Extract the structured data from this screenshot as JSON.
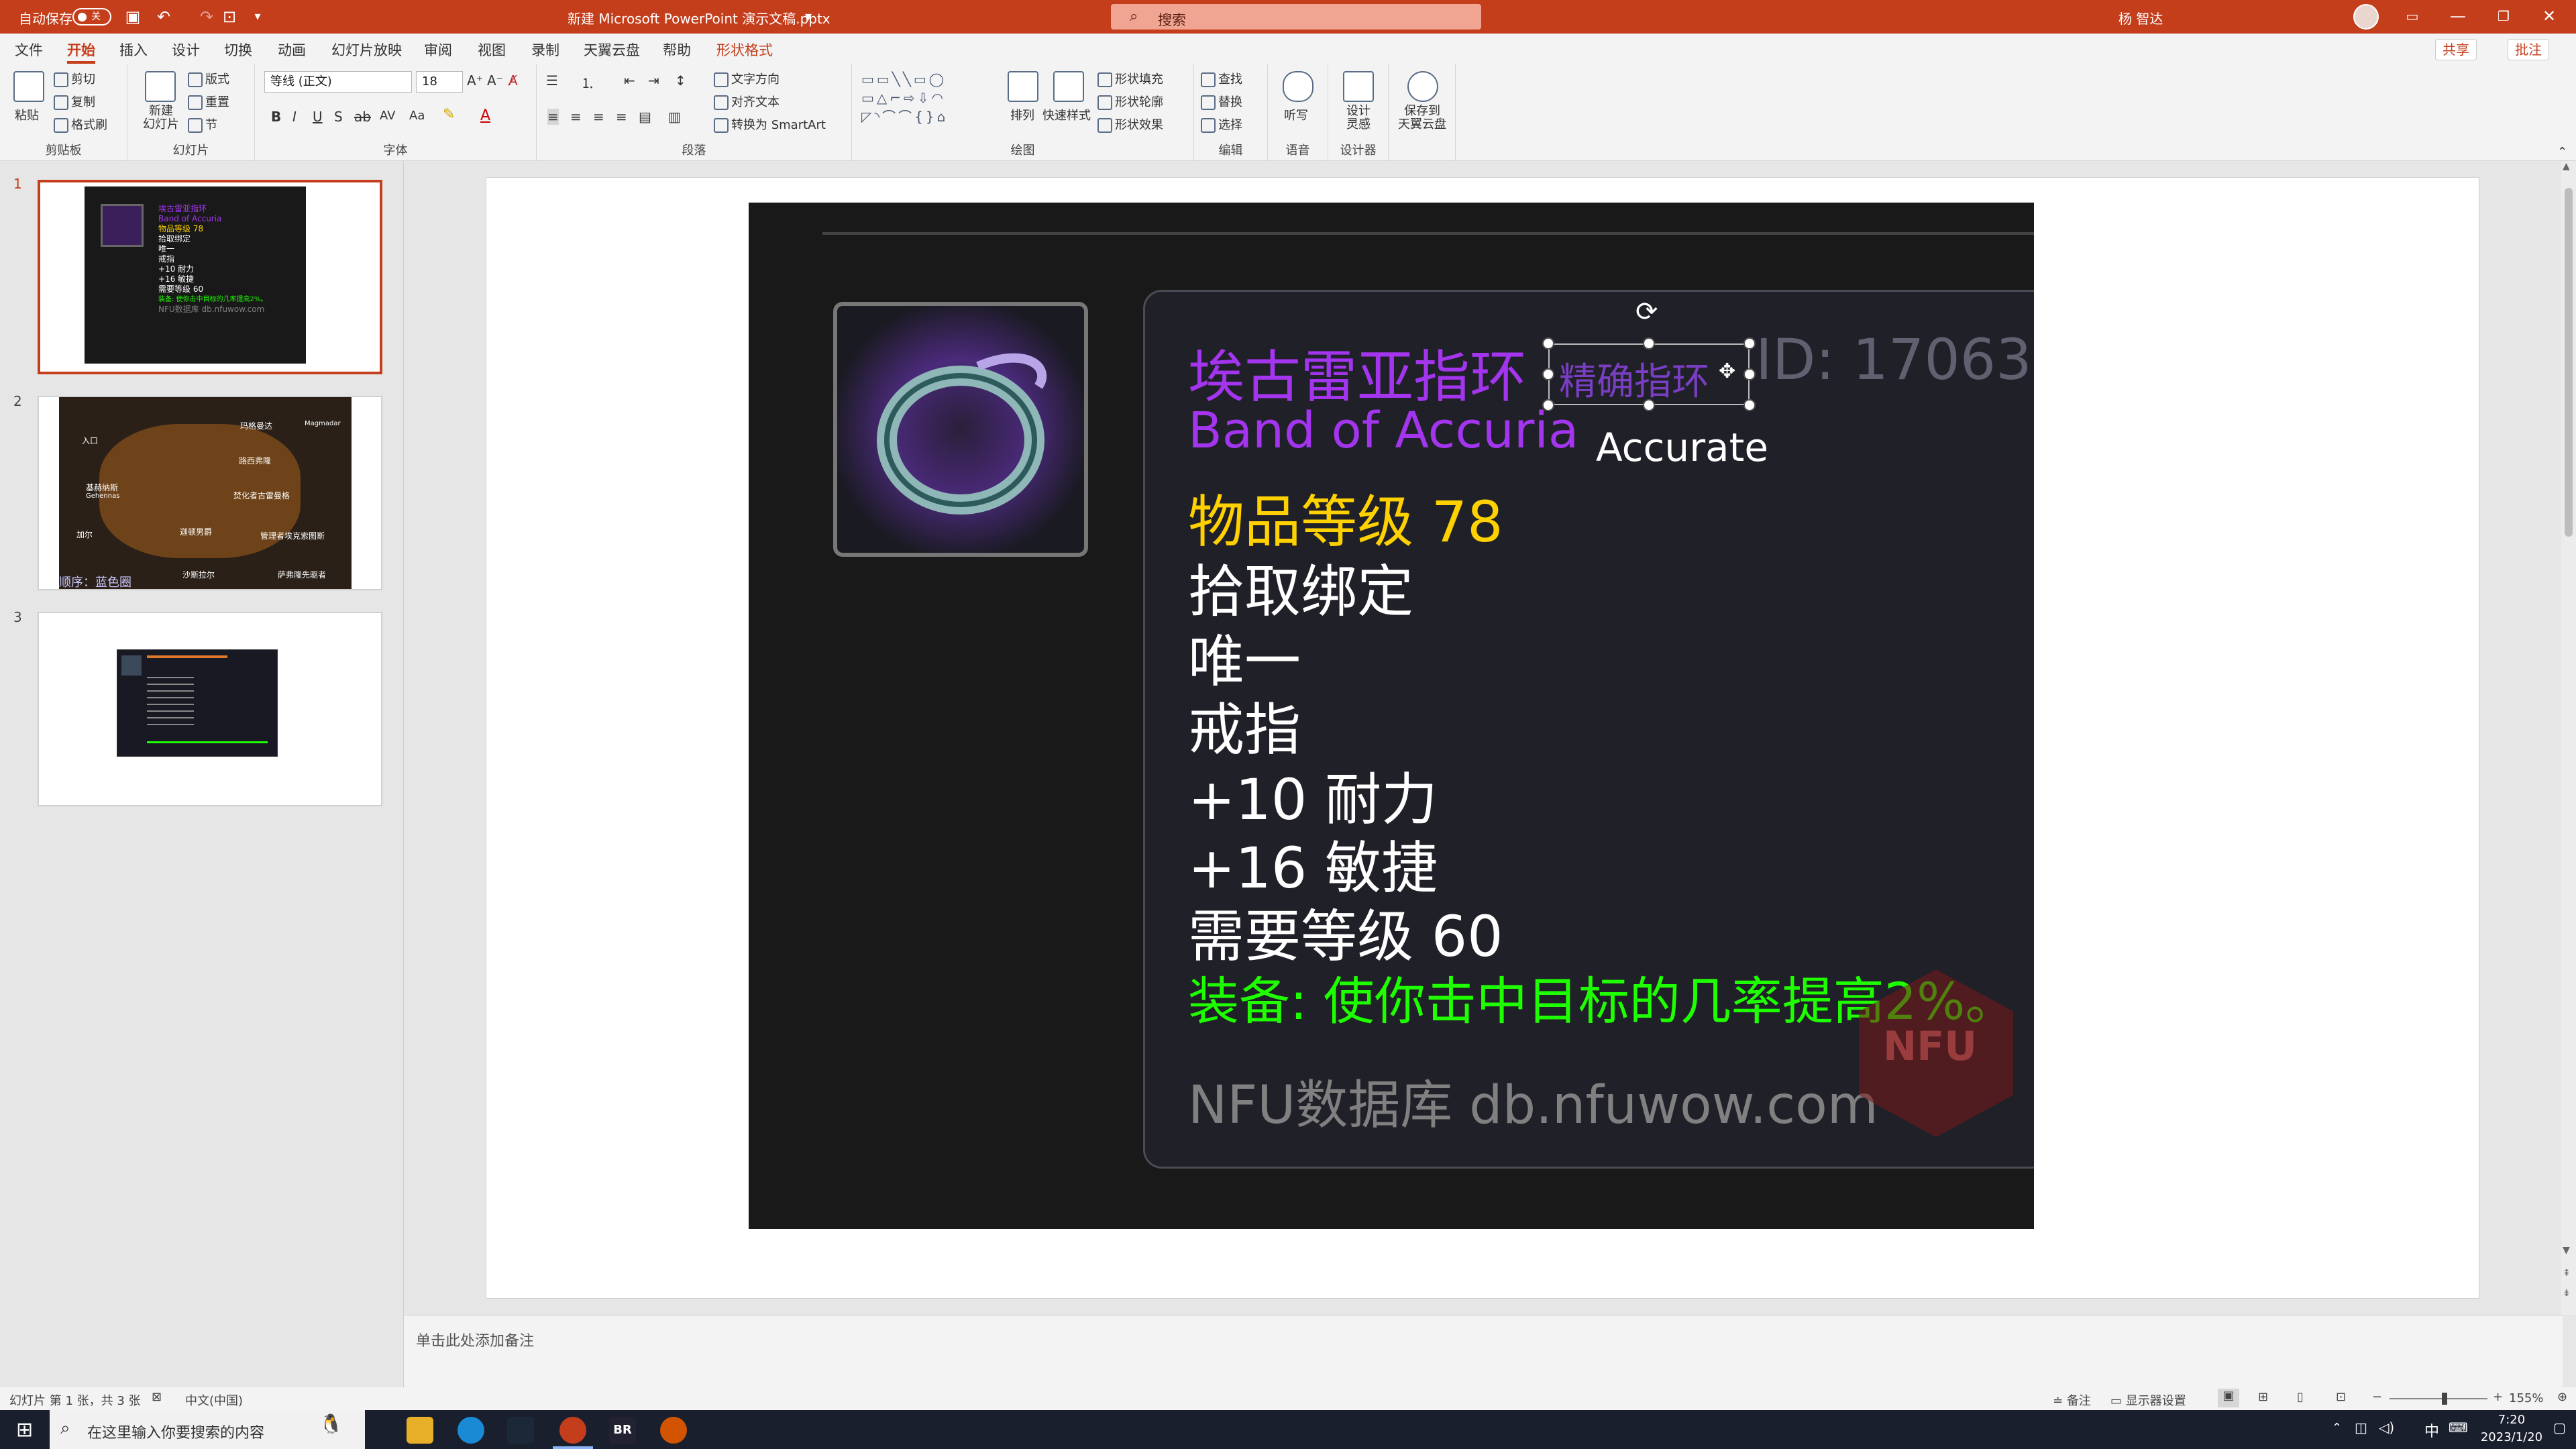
{
  "titlebar": {
    "autosave": "自动保存",
    "autosave_state": "关",
    "filename": "新建 Microsoft PowerPoint 演示文稿.pptx",
    "search_placeholder": "搜索",
    "user": "杨 智达",
    "bg_color": "#c43e1c"
  },
  "menu": {
    "tabs": [
      "文件",
      "开始",
      "插入",
      "设计",
      "切换",
      "动画",
      "幻灯片放映",
      "审阅",
      "视图",
      "录制",
      "天翼云盘",
      "帮助",
      "形状格式"
    ],
    "active": "开始",
    "share": "共享",
    "comment": "批注"
  },
  "ribbon": {
    "clipboard": {
      "paste": "粘贴",
      "cut": "剪切",
      "copy": "复制",
      "format_painter": "格式刷",
      "label": "剪贴板"
    },
    "slides": {
      "new_slide": "新建\n幻灯片",
      "layout": "版式",
      "reset": "重置",
      "section": "节",
      "label": "幻灯片"
    },
    "font": {
      "name": "等线 (正文)",
      "size": "18",
      "label": "字体"
    },
    "paragraph": {
      "text_direction": "文字方向",
      "align_text": "对齐文本",
      "smartart": "转换为 SmartArt",
      "label": "段落"
    },
    "drawing": {
      "arrange": "排列",
      "quick_styles": "快速样式",
      "fill": "形状填充",
      "outline": "形状轮廓",
      "effects": "形状效果",
      "label": "绘图"
    },
    "editing": {
      "find": "查找",
      "replace": "替换",
      "select": "选择",
      "label": "编辑"
    },
    "voice": {
      "dictate": "听写",
      "label": "语音"
    },
    "designer": {
      "ideas": "设计\n灵感",
      "label": "设计器"
    },
    "cloud": {
      "save": "保存到\n天翼云盘"
    }
  },
  "slides_panel": {
    "slides": [
      {
        "number": "1",
        "selected": true
      },
      {
        "number": "2",
        "selected": false,
        "caption": "顺序：蓝色圈"
      },
      {
        "number": "3",
        "selected": false
      }
    ],
    "thumb1_lines": [
      "埃古雷亚指环",
      "Band of Accuria",
      "物品等级 78",
      "拾取绑定",
      "唯一",
      "戒指",
      "+10 耐力",
      "+16 敏捷",
      "需要等级 60",
      "装备: 使你击中目标的几率提高2%。",
      "NFU数据库 db.nfuwow.com"
    ],
    "thumb2_labels": [
      "入口",
      "玛格曼达",
      "Magmadar",
      "路西弗隆",
      "基赫纳斯",
      "Gehennas",
      "加尔",
      "迦顿男爵",
      "沙斯拉尔",
      "焚化者古雷曼格",
      "管理者埃克索图斯",
      "萨弗隆先驱者"
    ]
  },
  "slide": {
    "item_name_cn": "埃古雷亚指环",
    "item_name_en": "Band of Accuria",
    "item_level": "物品等级 78",
    "bind": "拾取绑定",
    "unique": "唯一",
    "slot": "戒指",
    "stamina": "+10 耐力",
    "agility": "+16 敏捷",
    "req_level": "需要等级 60",
    "equip": "装备: 使你击中目标的几率提高2%。",
    "source": "NFU数据库 db.nfuwow.com",
    "id_label": "ID: 17063",
    "selected_textbox": "精确指环",
    "accurate": "Accurate",
    "watermark": "NFU",
    "colors": {
      "epic": "#a335ee",
      "gold": "#ffd100",
      "white": "#ffffff",
      "green": "#1eff00",
      "grey": "#808080"
    }
  },
  "notes_placeholder": "单击此处添加备注",
  "status": {
    "slide_info": "幻灯片 第 1 张，共 3 张",
    "language": "中文(中国)",
    "notes": "备注",
    "display_settings": "显示器设置",
    "zoom": "155%"
  },
  "taskbar": {
    "search_placeholder": "在这里输入你要搜索的内容",
    "time": "7:20",
    "date": "2023/1/20",
    "ime": "中",
    "app_br": "BR"
  }
}
